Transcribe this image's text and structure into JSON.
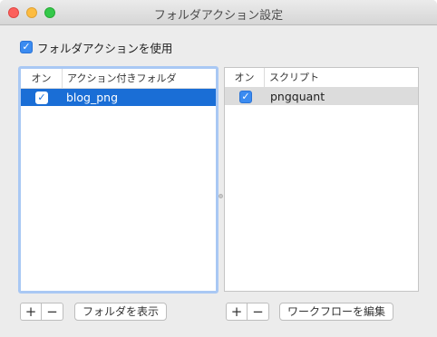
{
  "window": {
    "title": "フォルダアクション設定"
  },
  "enable": {
    "checked": true,
    "check_glyph": "✓",
    "label": "フォルダアクションを使用"
  },
  "folders_table": {
    "header_on": "オン",
    "header_name": "アクション付きフォルダ",
    "rows": [
      {
        "enabled": true,
        "check_glyph": "✓",
        "name": "blog_png",
        "selected": true
      }
    ]
  },
  "scripts_table": {
    "header_on": "オン",
    "header_name": "スクリプト",
    "rows": [
      {
        "enabled": true,
        "check_glyph": "✓",
        "name": "pngquant",
        "selected": true
      }
    ]
  },
  "buttons": {
    "add": "+",
    "remove": "−",
    "show_folder": "フォルダを表示",
    "edit_workflow": "ワークフローを編集"
  },
  "colors": {
    "accent": "#1a6ed6",
    "checkbox": "#3b8bf0",
    "focus_ring": "#a9c8f4"
  }
}
